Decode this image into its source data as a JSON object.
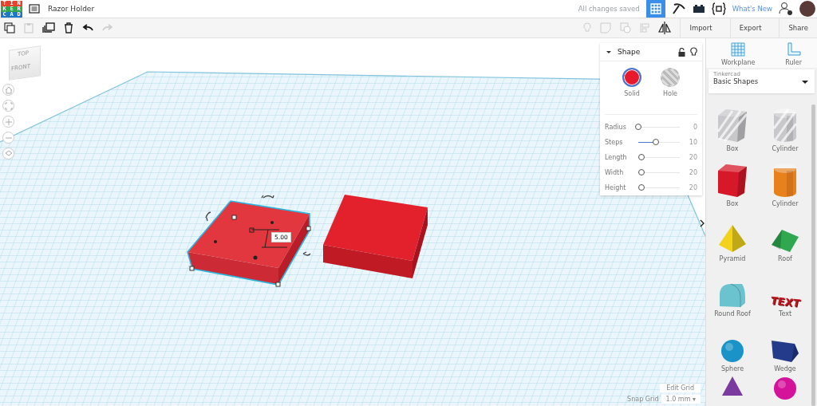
{
  "logo": {
    "letters": [
      "T",
      "I",
      "N",
      "K",
      "E",
      "R",
      "C",
      "A",
      "D"
    ]
  },
  "document": {
    "title": "Razor Holder"
  },
  "topbar": {
    "save_status": "All changes saved",
    "whats_new": "What's New"
  },
  "toolbar": {
    "actions": [
      "Import",
      "Export",
      "Share"
    ]
  },
  "viewcube": {
    "top": "TOP",
    "front": "FRONT"
  },
  "canvas": {
    "dimension": "5.00",
    "edit_grid": "Edit Grid",
    "snap_label": "Snap Grid",
    "snap_value": "1.0 mm ▾"
  },
  "inspector": {
    "title": "Shape",
    "modes": [
      {
        "label": "Solid",
        "selected": true
      },
      {
        "label": "Hole",
        "selected": false
      }
    ],
    "params": [
      {
        "label": "Radius",
        "value": "0",
        "level": 0
      },
      {
        "label": "Steps",
        "value": "10",
        "level": 0.42
      },
      {
        "label": "Length",
        "value": "20",
        "level": 0.08
      },
      {
        "label": "Width",
        "value": "20",
        "level": 0.08
      },
      {
        "label": "Height",
        "value": "20",
        "level": 0.08
      }
    ]
  },
  "panel": {
    "tools": [
      {
        "label": "Workplane",
        "kind": "workplane"
      },
      {
        "label": "Ruler",
        "kind": "ruler"
      }
    ],
    "library": {
      "source": "Tinkercad",
      "name": "Basic Shapes"
    },
    "shapes": [
      {
        "label": "Box",
        "kind": "box",
        "color": "#c8c8cc",
        "hole": true
      },
      {
        "label": "Cylinder",
        "kind": "cylinder",
        "color": "#c8c8cc",
        "hole": true
      },
      {
        "label": "Box",
        "kind": "box",
        "color": "#d7182a",
        "hole": false
      },
      {
        "label": "Cylinder",
        "kind": "cylinder",
        "color": "#e8801c",
        "hole": false
      },
      {
        "label": "Pyramid",
        "kind": "pyramid",
        "color": "#f2d21b",
        "hole": false
      },
      {
        "label": "Roof",
        "kind": "roof",
        "color": "#2fa84f",
        "hole": false
      },
      {
        "label": "Round Roof",
        "kind": "roundroof",
        "color": "#6cc3d0",
        "hole": false
      },
      {
        "label": "Text",
        "kind": "text",
        "glyph": "TEXT",
        "color": "#c0161f",
        "hole": false
      },
      {
        "label": "Sphere",
        "kind": "sphere",
        "color": "#1a93c9",
        "hole": false
      },
      {
        "label": "Wedge",
        "kind": "wedge",
        "color": "#243a8a",
        "hole": false
      },
      {
        "kind": "cone",
        "color": "#7a3aa0",
        "hole": false
      },
      {
        "kind": "sphere",
        "color": "#d4129a",
        "hole": false
      }
    ]
  }
}
